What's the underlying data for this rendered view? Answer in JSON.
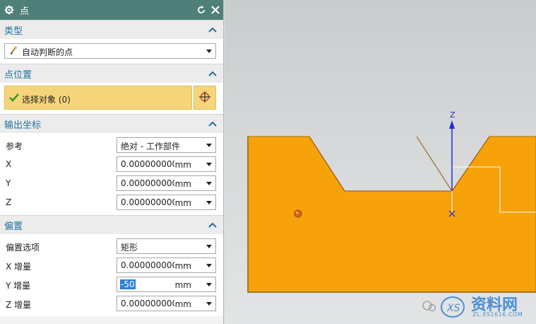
{
  "dialog": {
    "title": "点"
  },
  "type_section": {
    "title": "类型",
    "type_value": "自动判断的点"
  },
  "point_location": {
    "title": "点位置",
    "select_label": "选择对象 (0)"
  },
  "output_coords": {
    "title": "输出坐标",
    "reference_label": "参考",
    "reference_value": "绝对 - 工作部件",
    "x_label": "X",
    "x_value": "0.0000000000",
    "x_unit": "mm",
    "y_label": "Y",
    "y_value": "0.0000000000",
    "y_unit": "mm",
    "z_label": "Z",
    "z_value": "0.0000000000",
    "z_unit": "mm"
  },
  "offset": {
    "title": "偏置",
    "option_label": "偏置选项",
    "option_value": "矩形",
    "dx_label": "X 增量",
    "dx_value": "0.0000000000",
    "dx_unit": "mm",
    "dy_label": "Y 增量",
    "dy_value": "-50",
    "dy_unit": "mm",
    "dz_label": "Z 增量",
    "dz_value": "0.0000000000",
    "dz_unit": "mm"
  },
  "viewport": {
    "axis_z_label": "Z",
    "part_color": "#f7a20a"
  },
  "watermark": {
    "text": "资料网",
    "url": "ZL.XS1616.COM"
  },
  "colors": {
    "title_bar": "#4e7f78",
    "section_title": "#1f6f9c",
    "selection_fill": "#f6d57a"
  }
}
